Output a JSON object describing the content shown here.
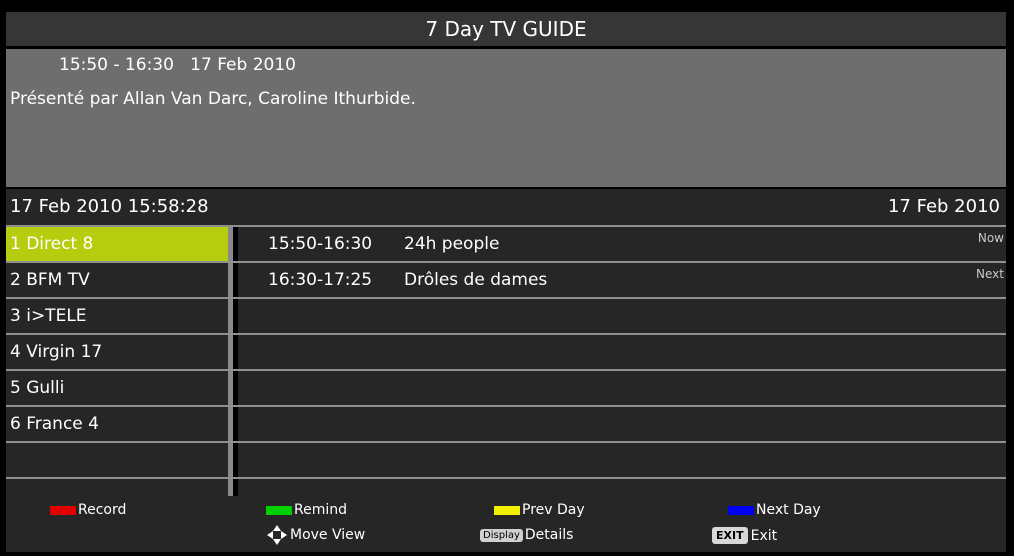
{
  "title": "7 Day TV GUIDE",
  "info": {
    "time_range": "15:50 - 16:30",
    "date": "17 Feb 2010",
    "description": "Présenté par Allan Van Darc, Caroline Ithurbide."
  },
  "datebar": {
    "current": "17 Feb 2010 15:58:28",
    "day": "17 Feb 2010"
  },
  "channels": [
    {
      "label": "1 Direct 8",
      "selected": true
    },
    {
      "label": "2 BFM TV"
    },
    {
      "label": "3 i>TELE"
    },
    {
      "label": "4 Virgin 17"
    },
    {
      "label": "5 Gulli"
    },
    {
      "label": "6 France 4"
    },
    {
      "label": ""
    },
    {
      "label": ""
    }
  ],
  "programs": [
    {
      "time": "15:50-16:30",
      "name": "24h people",
      "tag": "Now"
    },
    {
      "time": "16:30-17:25",
      "name": "Drôles de dames",
      "tag": "Next"
    }
  ],
  "footer": {
    "record": "Record",
    "remind": "Remind",
    "prev_day": "Prev Day",
    "next_day": "Next Day",
    "move_view": "Move View",
    "display_btn": "Display",
    "details": "Details",
    "exit_btn": "EXIT",
    "exit": "Exit"
  },
  "colors": {
    "red": "#e00000",
    "green": "#00d000",
    "yellow": "#f0f000",
    "blue": "#0000f0",
    "selected": "#b6cc0e"
  }
}
